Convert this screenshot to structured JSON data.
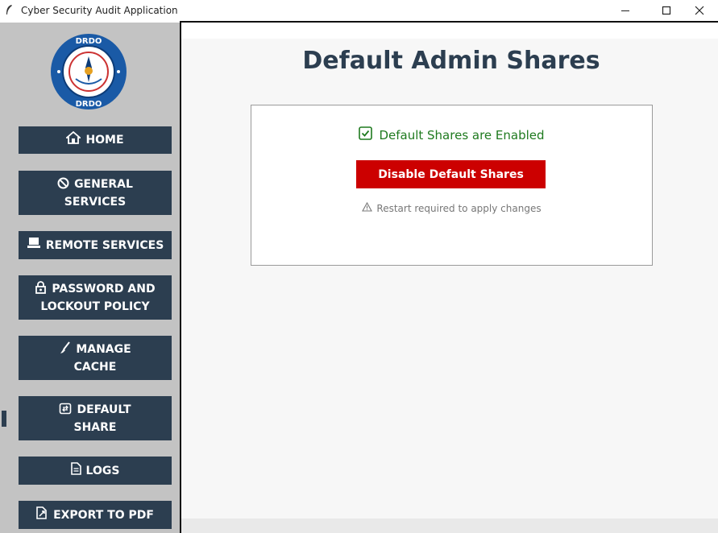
{
  "window": {
    "title": "Cyber Security Audit Application",
    "controls": [
      "minimize",
      "maximize",
      "close"
    ]
  },
  "sidebar": {
    "logo_text": "DRDO",
    "items": [
      {
        "line1": "HOME",
        "line2": "",
        "icon": "home-icon"
      },
      {
        "line1": "GENERAL",
        "line2": "SERVICES",
        "icon": "prohibited-icon"
      },
      {
        "line1": "REMOTE SERVICES",
        "line2": "",
        "icon": "laptop-icon"
      },
      {
        "line1": "PASSWORD AND",
        "line2": "LOCKOUT POLICY",
        "icon": "lock-icon"
      },
      {
        "line1": "MANAGE",
        "line2": "CACHE",
        "icon": "broom-icon"
      },
      {
        "line1": "DEFAULT",
        "line2": "SHARE",
        "icon": "share-icon"
      },
      {
        "line1": "LOGS",
        "line2": "",
        "icon": "document-icon"
      },
      {
        "line1": "EXPORT TO PDF",
        "line2": "",
        "icon": "export-icon"
      }
    ],
    "active_index": 5
  },
  "main": {
    "title": "Default Admin Shares",
    "status_text": "Default Shares are Enabled",
    "action_button": "Disable Default Shares",
    "note": "Restart required to apply changes"
  },
  "colors": {
    "nav_bg": "#2c3e50",
    "sidebar_bg": "#c3c3c3",
    "danger": "#cc0000",
    "success": "#1f7a1f",
    "title": "#2c3e50"
  }
}
